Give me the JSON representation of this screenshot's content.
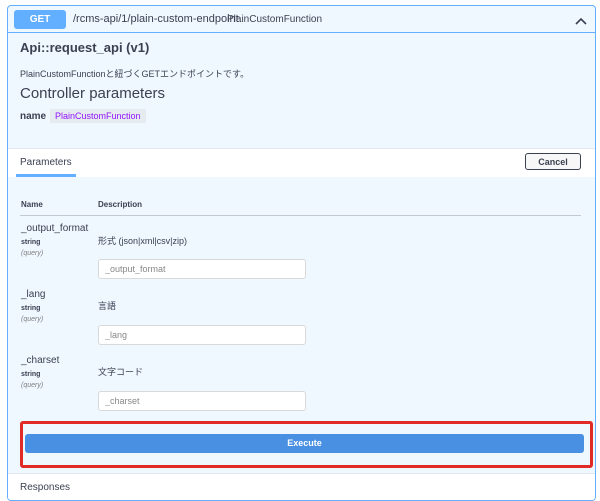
{
  "operation": {
    "method": "GET",
    "path": "/rcms-api/1/plain-custom-endpoint",
    "path_description": "PlainCustomFunction",
    "title": "Api::request_api (v1)",
    "description": "PlainCustomFunctionと紐づくGETエンドポイントです。",
    "collapse_icon": "chevron-up-icon"
  },
  "controller": {
    "heading": "Controller parameters",
    "name_key": "name",
    "name_value": "PlainCustomFunction"
  },
  "parameters": {
    "tab_label": "Parameters",
    "cancel_label": "Cancel",
    "col_name": "Name",
    "col_description": "Description",
    "items": [
      {
        "name": "_output_format",
        "type": "string",
        "in": "(query)",
        "description": "形式 (json|xml|csv|zip)",
        "placeholder": "_output_format",
        "value": ""
      },
      {
        "name": "_lang",
        "type": "string",
        "in": "(query)",
        "description": "言語",
        "placeholder": "_lang",
        "value": ""
      },
      {
        "name": "_charset",
        "type": "string",
        "in": "(query)",
        "description": "文字コード",
        "placeholder": "_charset",
        "value": ""
      }
    ]
  },
  "execute": {
    "label": "Execute"
  },
  "responses": {
    "label": "Responses"
  },
  "colors": {
    "method_get": "#61affe",
    "execute": "#4990e2",
    "highlight_border": "#e02b27",
    "name_value_text": "#9012fe"
  }
}
